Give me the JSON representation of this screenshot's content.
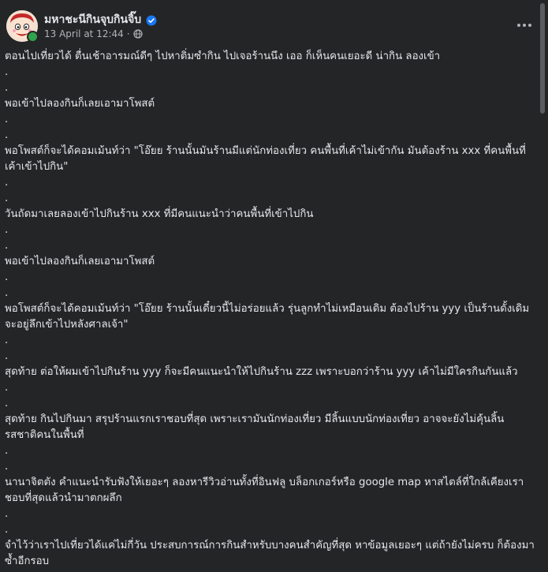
{
  "post": {
    "author": "มหาชะนีกินจุบกินจิ๊บ",
    "timestamp": "13 April at 12:44",
    "separator": "·",
    "lines": [
      "ตอนไปเที่ยวได้ ตื่นเช้าอารมณ์ดีๆ ไปหาติ่มซำกิน ไปเจอร้านนึง เออ ก็เห็นคนเยอะดี น่ากิน ลองเข้า",
      ".",
      ".",
      "พอเข้าไปลองกินก็เลยเอามาโพสต์",
      ".",
      ".",
      "พอโพสต์ก็จะได้คอมเม้นท์ว่า \"โอ๊ยย ร้านนั้นมันร้านมีแต่นักท่องเที่ยว คนพื้นที่เค้าไม่เข้ากัน มันต้องร้าน xxx ที่คนพื้นที่เค้าเข้าไปกิน\"",
      ".",
      ".",
      "วันถัดมาเลยลองเข้าไปกินร้าน xxx ที่มีคนแนะนำว่าคนพื้นที่เข้าไปกิน",
      ".",
      ".",
      "พอเข้าไปลองกินก็เลยเอามาโพสต์",
      ".",
      ".",
      "พอโพสต์ก็จะได้คอมเม้นท์ว่า \"โอ๊ยย ร้านนั้นเดี๋ยวนี้ไม่อร่อยแล้ว รุ่นลูกทำไม่เหมือนเดิม ต้องไปร้าน yyy เป็นร้านดั้งเดิม จะอยู่ลึกเข้าไปหลังศาลเจ้า\"",
      ".",
      ".",
      "สุดท้าย ต่อให้ผมเข้าไปกินร้าน yyy ก็จะมีคนแนะนำให้ไปกินร้าน zzz เพราะบอกว่าร้าน yyy เค้าไม่มีใครกินกันแล้ว",
      ".",
      ".",
      "สุดท้าย กินไปกินมา สรุปร้านแรกเราชอบที่สุด เพราะเรามันนักท่องเที่ยว มีลิ้นแบบนักท่องเที่ยว อาจจะยังไม่คุ้นลิ้นรสชาติคนในพื้นที่",
      ".",
      ".",
      "นานาจิตตัง คำแนะนำรับฟังให้เยอะๆ ลองหารีวิวอ่านทั้งที่อินฟลู บล็อกเกอร์หรือ google map หาสไตล์ที่ใกล้เคียงเราชอบที่สุดแล้วนำมาตกผลึก",
      ".",
      ".",
      "จำไว้ว่าเราไปเที่ยวได้แค่ไม่กี่วัน ประสบการณ์การกินสำหรับบางคนสำคัญที่สุด หาข้อมูลเยอะๆ แต่ถ้ายังไม่ครบ ก็ต้องมาซ้ำอีกรอบ"
    ]
  },
  "icons": {
    "verified": "verified-badge-icon",
    "audience": "globe-icon",
    "more": "more-options-icon"
  },
  "colors": {
    "background": "#242526",
    "text_primary": "#e4e6eb",
    "text_secondary": "#b0b3b8",
    "verified_blue": "#1877f2",
    "online_green": "#31a24c"
  }
}
